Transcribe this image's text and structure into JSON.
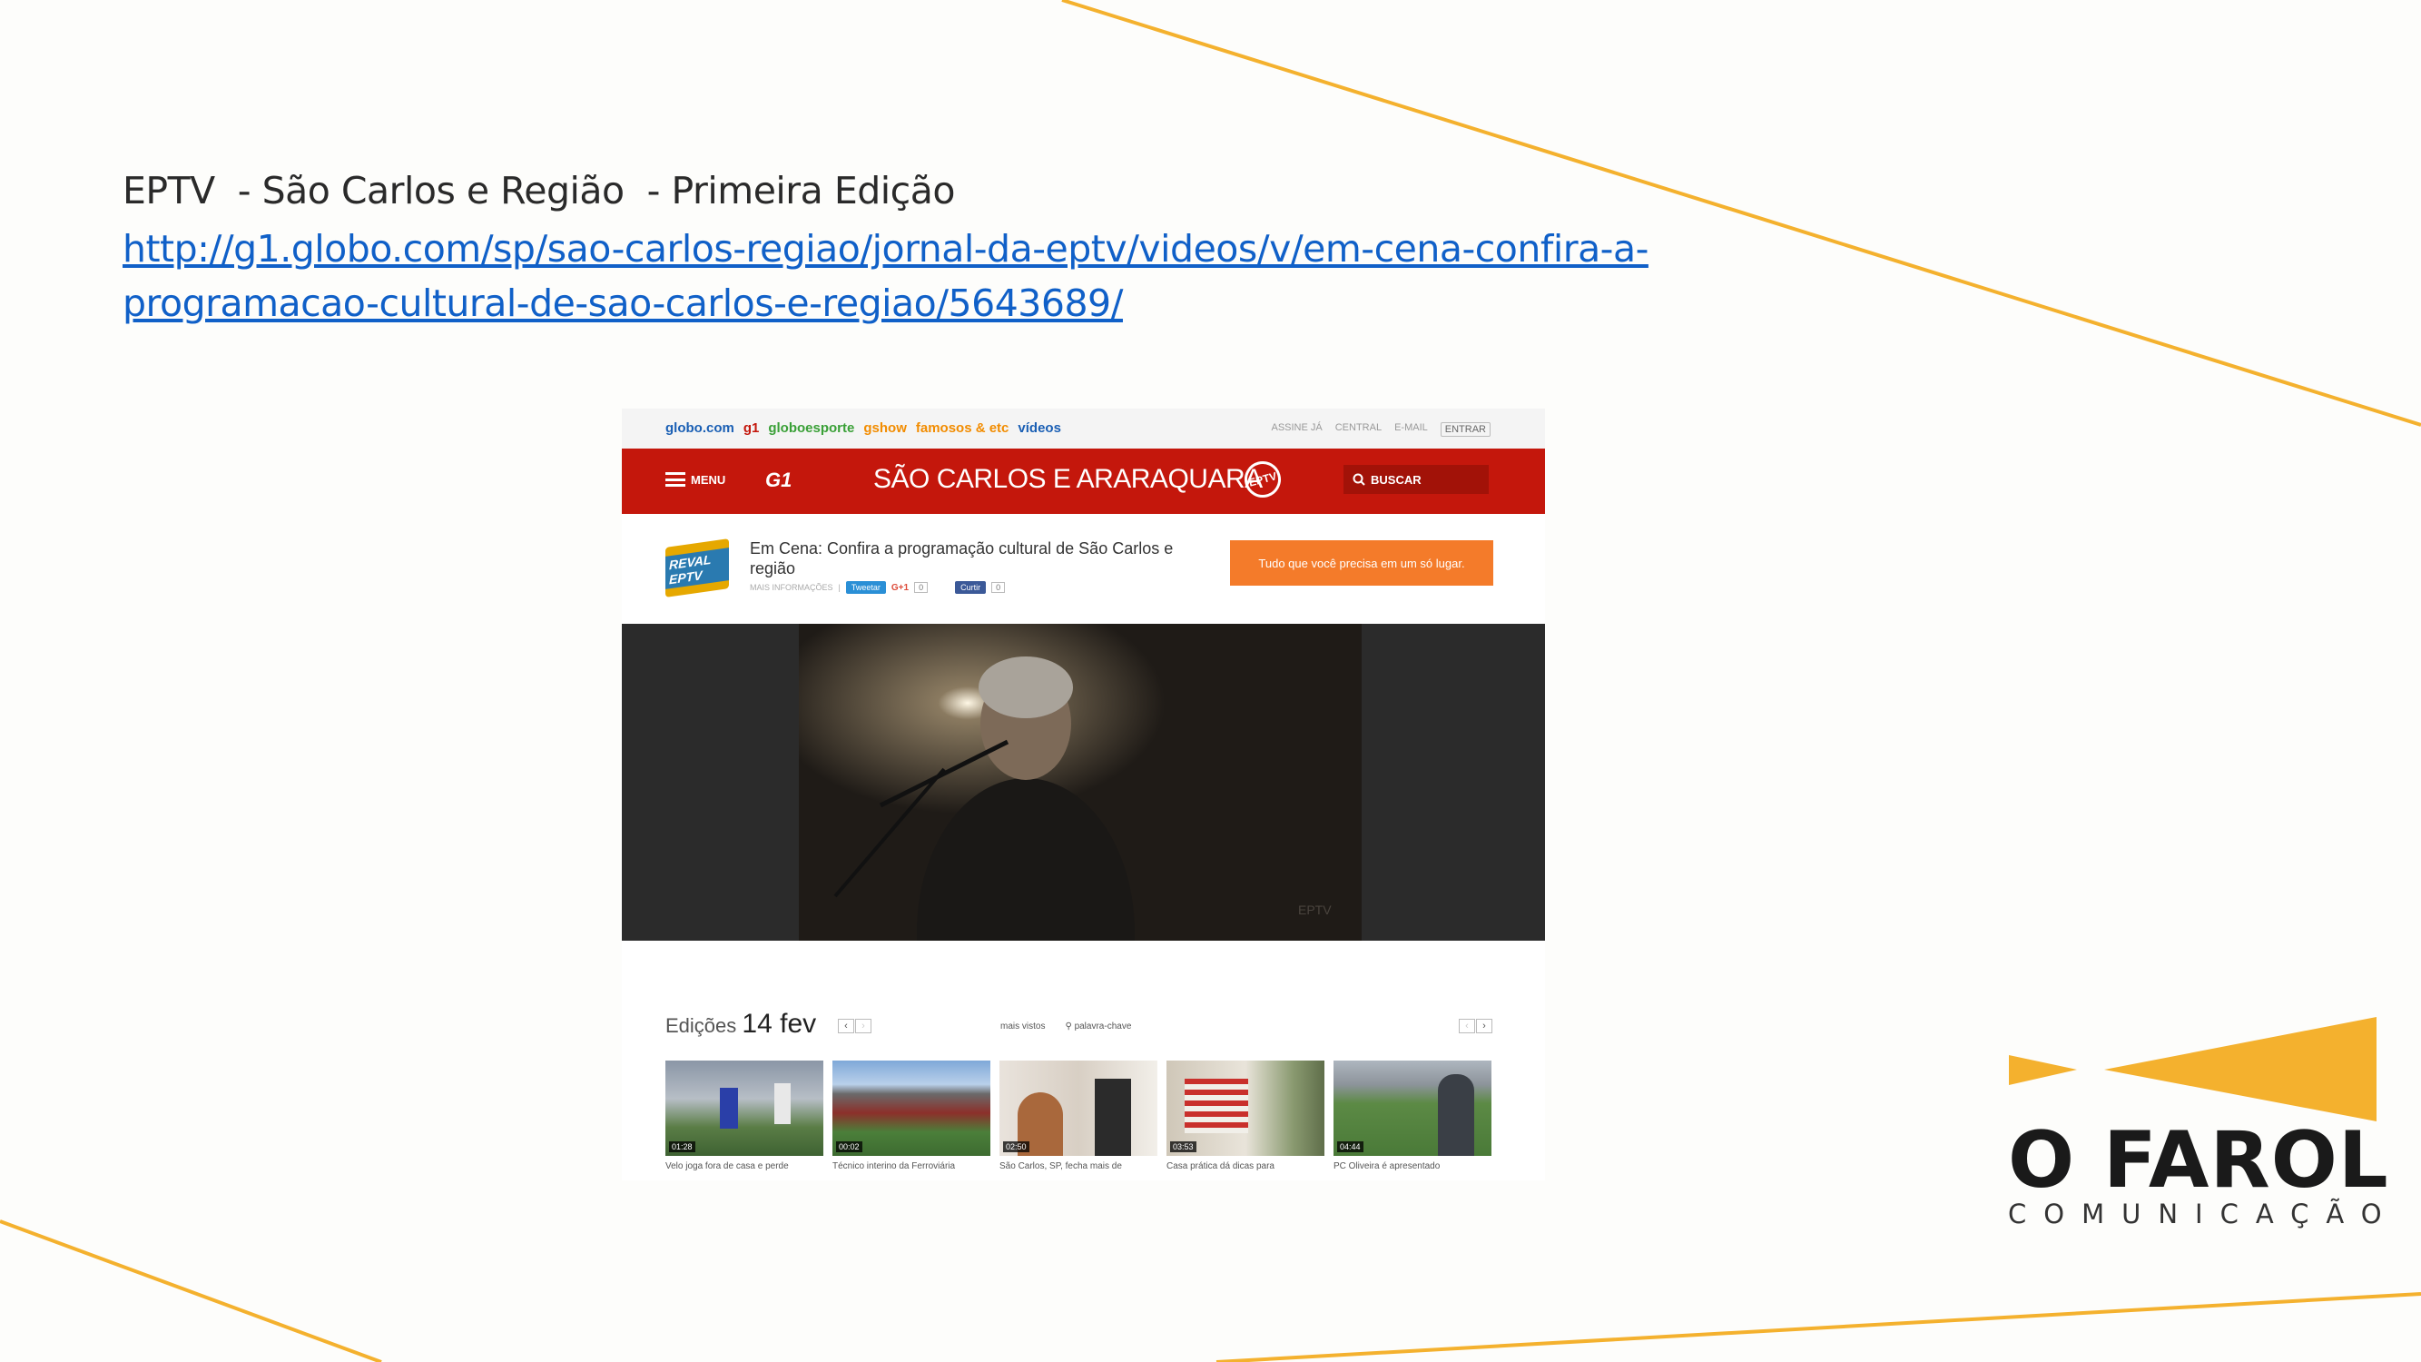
{
  "slide": {
    "title": "EPTV  - São Carlos e Região  - Primeira Edição",
    "link_line1": "http://g1.globo.com/sp/sao-carlos-regiao/jornal-da-eptv/videos/v/em-cena-confira-a-",
    "link_line2": "programacao-cultural-de-sao-carlos-e-regiao/5643689/"
  },
  "colors": {
    "accent_orange": "#f4b12e",
    "g1_red": "#c4170c",
    "link_blue": "#1060c8"
  },
  "screenshot": {
    "topbar_links": [
      {
        "label": "globo.com",
        "color": "#1a5fb4"
      },
      {
        "label": "g1",
        "color": "#c4170c"
      },
      {
        "label": "globoesporte",
        "color": "#3aa037"
      },
      {
        "label": "gshow",
        "color": "#f28c00"
      },
      {
        "label": "famosos & etc",
        "color": "#f28c00"
      },
      {
        "label": "vídeos",
        "color": "#1a5fb4"
      }
    ],
    "topbar_right": [
      "ASSINE JÁ",
      "CENTRAL",
      "E-MAIL"
    ],
    "enter_label": "ENTRAR",
    "menu_label": "MENU",
    "g1_logo": "G1",
    "region_title": "SÃO CARLOS E ARARAQUARA",
    "eptv_badge": "EPTV",
    "search_label": "BUSCAR",
    "video_badge": "REVAL EPTV",
    "video_title": "Em Cena: Confira a programação cultural de São Carlos e região",
    "more_info": "MAIS INFORMAÇÕES",
    "tweet_label": "Tweetar",
    "gplus_label": "G+1",
    "gplus_count": "0",
    "like_label": "Curtir",
    "like_count": "0",
    "promo_text": "Tudo que você precisa em um só lugar.",
    "player_watermark": "EPTV",
    "editions_label": "Edições",
    "editions_date": "14 fev",
    "filter_most_viewed": "mais vistos",
    "filter_keyword": "palavra-chave",
    "thumbnails": [
      {
        "duration": "01:28",
        "caption": "Velo joga fora de casa e perde",
        "icon": "soccer-goal-photo"
      },
      {
        "duration": "00:02",
        "caption": "Técnico interino da Ferroviária",
        "icon": "stadium-photo"
      },
      {
        "duration": "02:50",
        "caption": "São Carlos, SP, fecha mais de",
        "icon": "office-photo"
      },
      {
        "duration": "03:53",
        "caption": "Casa prática dá dicas para",
        "icon": "house-photo"
      },
      {
        "duration": "04:44",
        "caption": "PC Oliveira é apresentado",
        "icon": "stadium-man-photo"
      }
    ]
  },
  "logo": {
    "wordmark": "O FAROL",
    "subtitle": "COMUNICAÇÃO"
  }
}
